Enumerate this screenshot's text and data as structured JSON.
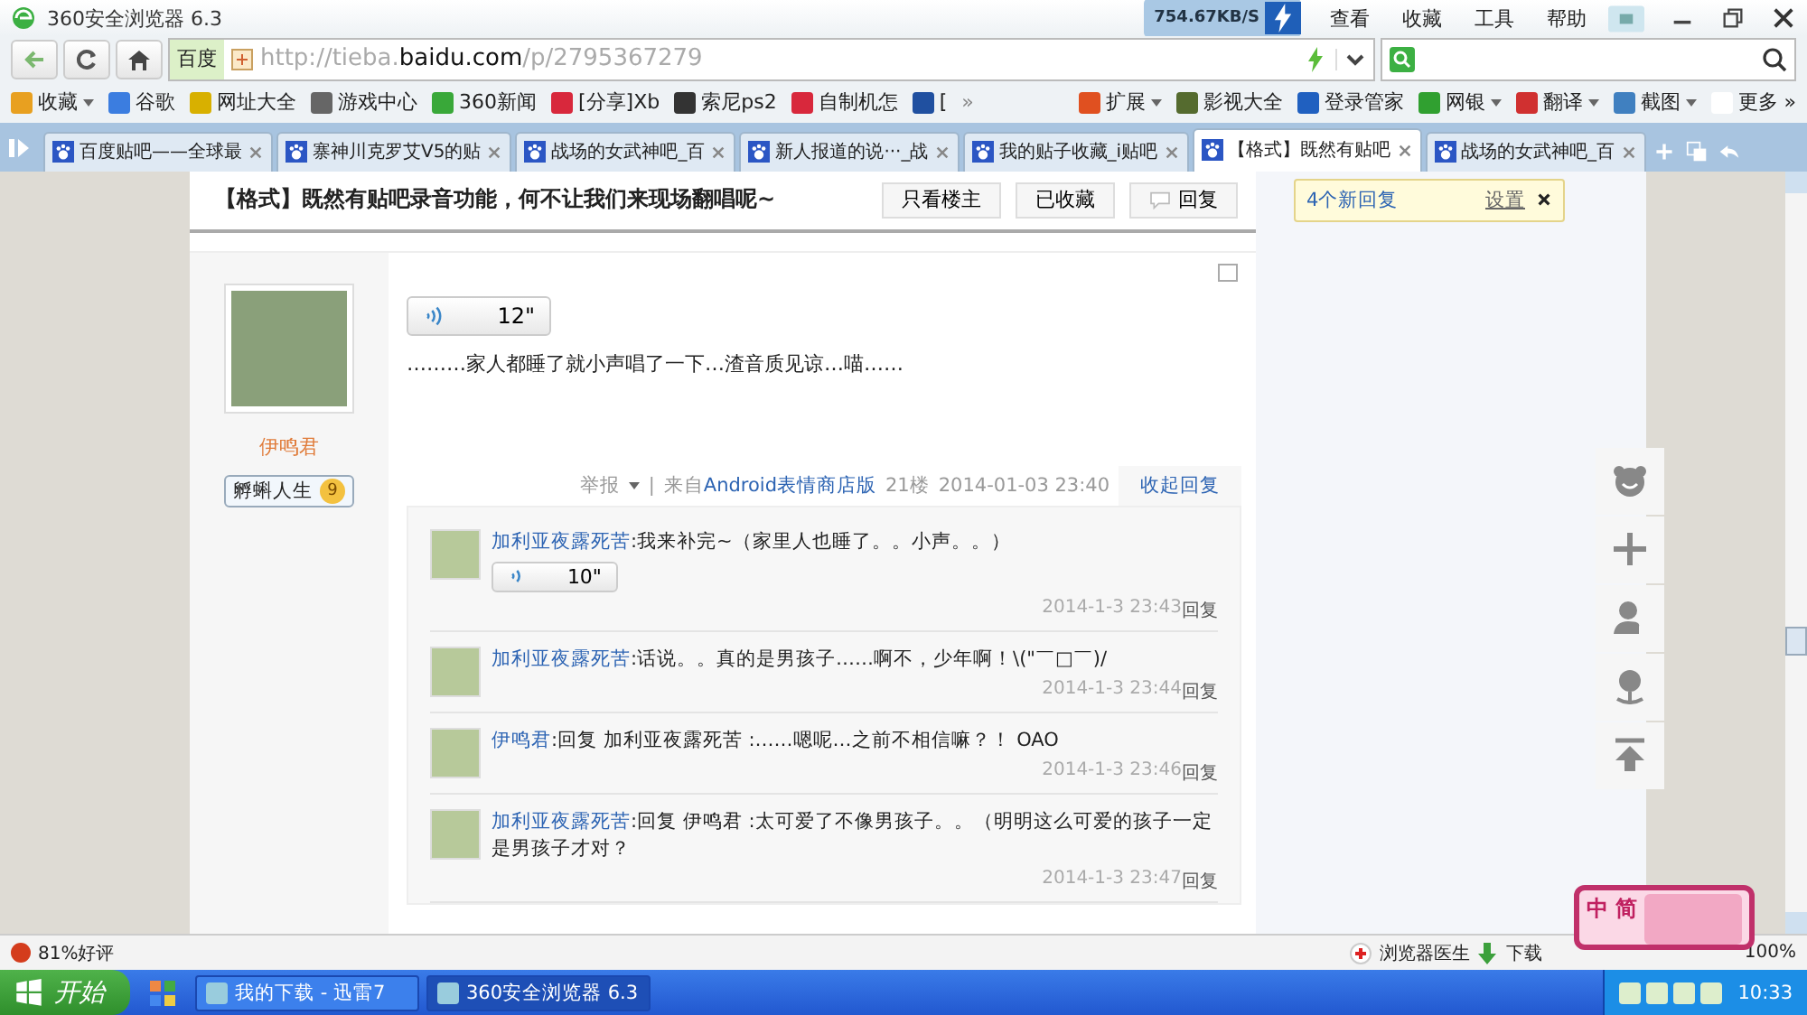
{
  "window": {
    "title": "360安全浏览器 6.3",
    "speed": "754.67KB/S",
    "menu": [
      "查看",
      "收藏",
      "工具",
      "帮助"
    ]
  },
  "address": {
    "engine": "百度",
    "url": [
      {
        "text": "http://tieba.",
        "strong": false
      },
      {
        "text": "baidu.com",
        "strong": true
      },
      {
        "text": "/p/2795367279",
        "strong": false
      }
    ]
  },
  "bookmarks_left": [
    {
      "label": "收藏",
      "color": "#e8a020",
      "dropdown": true
    },
    {
      "label": "谷歌",
      "color": "#3b7de0",
      "dropdown": false
    },
    {
      "label": "网址大全",
      "color": "#d8b000",
      "dropdown": false
    },
    {
      "label": "游戏中心",
      "color": "#666666",
      "dropdown": false
    },
    {
      "label": "360新闻",
      "color": "#39a839",
      "dropdown": false
    },
    {
      "label": "[分享]Xb",
      "color": "#d8283c",
      "dropdown": false
    },
    {
      "label": "索尼ps2",
      "color": "#333333",
      "dropdown": false
    },
    {
      "label": "自制机怎",
      "color": "#d8283c",
      "dropdown": false
    },
    {
      "label": "[",
      "color": "#2050a0",
      "dropdown": false
    }
  ],
  "bookmarks_overflow": "»",
  "bookmarks_right": [
    {
      "label": "扩展",
      "color": "#e05020",
      "dropdown": true
    },
    {
      "label": "影视大全",
      "color": "#556b2f",
      "dropdown": false
    },
    {
      "label": "登录管家",
      "color": "#2060c0",
      "dropdown": false
    },
    {
      "label": "网银",
      "color": "#30a030",
      "dropdown": true
    },
    {
      "label": "翻译",
      "color": "#d03030",
      "dropdown": true
    },
    {
      "label": "截图",
      "color": "#4080c0",
      "dropdown": true
    },
    {
      "label": "更多 »",
      "color": "#ffffff",
      "dropdown": false
    }
  ],
  "tabs": [
    {
      "label": "百度贴吧——全球最",
      "selected": false
    },
    {
      "label": "寨神川克罗艾V5的贴",
      "selected": false
    },
    {
      "label": "战场的女武神吧_百",
      "selected": false
    },
    {
      "label": "新人报道的说···_战",
      "selected": false
    },
    {
      "label": "我的贴子收藏_i贴吧",
      "selected": false
    },
    {
      "label": "【格式】既然有贴吧",
      "selected": true
    },
    {
      "label": "战场的女武神吧_百",
      "selected": false
    }
  ],
  "thread": {
    "title": "【格式】既然有贴吧录音功能，何不让我们来现场翻唱呢~",
    "buttons": [
      {
        "label": "只看楼主",
        "kind": "plain"
      },
      {
        "label": "已收藏",
        "kind": "plain"
      },
      {
        "label": "回复",
        "kind": "reply"
      }
    ]
  },
  "post": {
    "author": "伊鸣君",
    "badge": "孵蝌人生",
    "level": "9",
    "voice": "12\"",
    "text": "………家人都睡了就小声唱了一下…渣音质见谅…喵……",
    "report": "举报",
    "separator": "|",
    "source_prefix": "来自",
    "source": "Android表情商店版",
    "floor": "21楼",
    "time": "2014-01-03 23:40",
    "collapse": "收起回复"
  },
  "replies": [
    {
      "author": "加利亚夜露死苦",
      "text": ":我来补完~（家里人也睡了。。小声。。）",
      "voice": "10\"",
      "time": "2014-1-3 23:43",
      "action": "回复"
    },
    {
      "author": "加利亚夜露死苦",
      "text": ":话说。。真的是男孩子……啊不，少年啊！\\(\"￣□￣)/",
      "time": "2014-1-3 23:44",
      "action": "回复"
    },
    {
      "author": "伊鸣君",
      "text": ":回复 加利亚夜露死苦 :……嗯呢…之前不相信嘛？！ OAO",
      "time": "2014-1-3 23:46",
      "action": "回复"
    },
    {
      "author": "加利亚夜露死苦",
      "text": ":回复 伊鸣君 :太可爱了不像男孩子。。（明明这么可爱的孩子一定是男孩子才对？",
      "time": "2014-1-3 23:47",
      "action": "回复"
    }
  ],
  "notice": {
    "text": "4个新回复",
    "link": "设置"
  },
  "ime": [
    "中",
    "简"
  ],
  "status_bar": {
    "rating": "81%好评",
    "doctor": "浏览器医生",
    "download": "下载",
    "zoom": "100%"
  },
  "taskbar": {
    "start": "开始",
    "items": [
      {
        "label": "我的下载 - 迅雷7",
        "selected": false
      },
      {
        "label": "360安全浏览器 6.3",
        "selected": true
      }
    ],
    "clock": "10:33"
  }
}
